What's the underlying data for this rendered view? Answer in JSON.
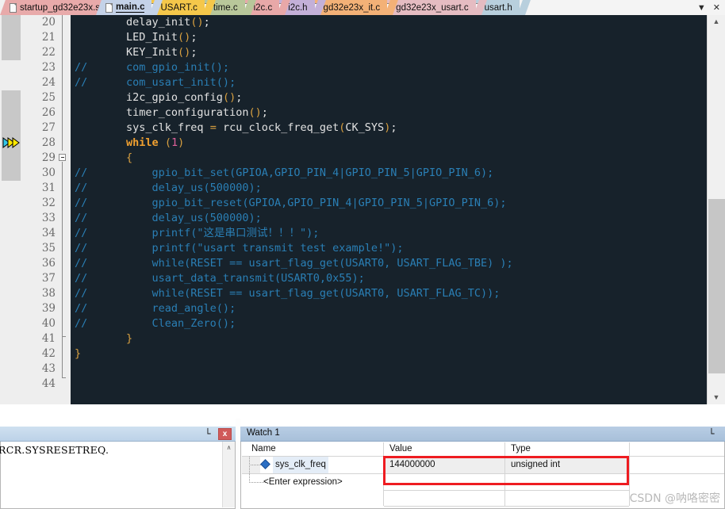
{
  "tabs": [
    {
      "label": "startup_gd32e23x.s",
      "color": "#e8aaaa",
      "active": false
    },
    {
      "label": "main.c",
      "color": "#c4d2e8",
      "active": true
    },
    {
      "label": "USART.c",
      "color": "#f5c74a",
      "active": false
    },
    {
      "label": "time.c",
      "color": "#b8c79a",
      "active": false
    },
    {
      "label": "i2c.c",
      "color": "#e8a8a8",
      "active": false
    },
    {
      "label": "i2c.h",
      "color": "#c3b0d8",
      "active": false
    },
    {
      "label": "gd32e23x_it.c",
      "color": "#f3b177",
      "active": false
    },
    {
      "label": "gd32e23x_usart.c",
      "color": "#e5bcc2",
      "active": false
    },
    {
      "label": "usart.h",
      "color": "#b8cfdd",
      "active": false
    }
  ],
  "tabbar": {
    "overflow_icon": "chevron-down-icon",
    "overflow_glyph": "▼",
    "close_icon": "close-icon",
    "close_glyph": "✕"
  },
  "editor": {
    "first_line": 20,
    "last_line": 44,
    "execution_line": 28,
    "lines": [
      {
        "n": 20,
        "tokens": [
          {
            "t": "        delay_init",
            "c": "k-plain"
          },
          {
            "t": "()",
            "c": "k-punct"
          },
          {
            "t": ";",
            "c": "k-plain"
          }
        ]
      },
      {
        "n": 21,
        "tokens": [
          {
            "t": "        LED_Init",
            "c": "k-plain"
          },
          {
            "t": "()",
            "c": "k-punct"
          },
          {
            "t": ";",
            "c": "k-plain"
          }
        ]
      },
      {
        "n": 22,
        "tokens": [
          {
            "t": "        KEY_Init",
            "c": "k-plain"
          },
          {
            "t": "()",
            "c": "k-punct"
          },
          {
            "t": ";",
            "c": "k-plain"
          }
        ]
      },
      {
        "n": 23,
        "tokens": [
          {
            "t": "//      com_gpio_init();",
            "c": "k-com"
          }
        ]
      },
      {
        "n": 24,
        "tokens": [
          {
            "t": "//      com_usart_init();",
            "c": "k-com"
          }
        ]
      },
      {
        "n": 25,
        "tokens": [
          {
            "t": "        i2c_gpio_config",
            "c": "k-plain"
          },
          {
            "t": "()",
            "c": "k-punct"
          },
          {
            "t": ";",
            "c": "k-plain"
          }
        ]
      },
      {
        "n": 26,
        "tokens": [
          {
            "t": "        timer_configuration",
            "c": "k-plain"
          },
          {
            "t": "()",
            "c": "k-punct"
          },
          {
            "t": ";",
            "c": "k-plain"
          }
        ]
      },
      {
        "n": 27,
        "tokens": [
          {
            "t": "        sys_clk_freq ",
            "c": "k-plain"
          },
          {
            "t": "=",
            "c": "k-punct"
          },
          {
            "t": " rcu_clock_freq_get",
            "c": "k-plain"
          },
          {
            "t": "(",
            "c": "k-punct"
          },
          {
            "t": "CK_SYS",
            "c": "k-plain"
          },
          {
            "t": ")",
            "c": "k-punct"
          },
          {
            "t": ";",
            "c": "k-plain"
          }
        ]
      },
      {
        "n": 28,
        "tokens": [
          {
            "t": "        ",
            "c": "k-plain"
          },
          {
            "t": "while",
            "c": "k-kw"
          },
          {
            "t": " ",
            "c": "k-plain"
          },
          {
            "t": "(",
            "c": "k-punct"
          },
          {
            "t": "1",
            "c": "k-num"
          },
          {
            "t": ")",
            "c": "k-punct"
          }
        ]
      },
      {
        "n": 29,
        "tokens": [
          {
            "t": "        ",
            "c": "k-plain"
          },
          {
            "t": "{",
            "c": "k-brace"
          }
        ]
      },
      {
        "n": 30,
        "tokens": [
          {
            "t": "//          gpio_bit_set(GPIOA,GPIO_PIN_4|GPIO_PIN_5|GPIO_PIN_6);",
            "c": "k-com"
          }
        ]
      },
      {
        "n": 31,
        "tokens": [
          {
            "t": "//          delay_us(500000);",
            "c": "k-com"
          }
        ]
      },
      {
        "n": 32,
        "tokens": [
          {
            "t": "//          gpio_bit_reset(GPIOA,GPIO_PIN_4|GPIO_PIN_5|GPIO_PIN_6);",
            "c": "k-com"
          }
        ]
      },
      {
        "n": 33,
        "tokens": [
          {
            "t": "//          delay_us(500000);",
            "c": "k-com"
          }
        ]
      },
      {
        "n": 34,
        "tokens": [
          {
            "t": "//          printf(\"这是串口测试！！！\");",
            "c": "k-com"
          }
        ]
      },
      {
        "n": 35,
        "tokens": [
          {
            "t": "//          printf(\"usart transmit test example!\");",
            "c": "k-com"
          }
        ]
      },
      {
        "n": 36,
        "tokens": [
          {
            "t": "//          while(RESET == usart_flag_get(USART0, USART_FLAG_TBE) );",
            "c": "k-com"
          }
        ]
      },
      {
        "n": 37,
        "tokens": [
          {
            "t": "//          usart_data_transmit(USART0,0x55);",
            "c": "k-com"
          }
        ]
      },
      {
        "n": 38,
        "tokens": [
          {
            "t": "//          while(RESET == usart_flag_get(USART0, USART_FLAG_TC));",
            "c": "k-com"
          }
        ]
      },
      {
        "n": 39,
        "tokens": [
          {
            "t": "//          read_angle();",
            "c": "k-com"
          }
        ]
      },
      {
        "n": 40,
        "tokens": [
          {
            "t": "//          Clean_Zero();",
            "c": "k-com"
          }
        ]
      },
      {
        "n": 41,
        "tokens": [
          {
            "t": "        ",
            "c": "k-plain"
          },
          {
            "t": "}",
            "c": "k-brace"
          }
        ]
      },
      {
        "n": 42,
        "tokens": [
          {
            "t": "",
            "c": "k-plain"
          },
          {
            "t": "}",
            "c": "k-brace"
          }
        ]
      },
      {
        "n": 43,
        "tokens": [
          {
            "t": "",
            "c": "k-plain"
          }
        ]
      },
      {
        "n": 44,
        "tokens": [
          {
            "t": "",
            "c": "k-plain"
          }
        ]
      }
    ],
    "scrollbar": {
      "v_up_glyph": "▲",
      "v_down_glyph": "▼",
      "h_left_glyph": "❮",
      "h_right_glyph": "❯"
    }
  },
  "left_panel": {
    "pin_icon": "pin-icon",
    "pin_glyph": "└",
    "close_icon": "close-icon",
    "close_label": "x",
    "content_text": "RCR.SYSRESETREQ.",
    "scroll_up_glyph": "∧"
  },
  "watch": {
    "title": "Watch 1",
    "pin_icon": "pin-icon",
    "pin_glyph": "└",
    "columns": [
      "Name",
      "Value",
      "Type"
    ],
    "rows": [
      {
        "name": "sys_clk_freq",
        "value": "144000000",
        "type": "unsigned int",
        "icon": "diamond-icon"
      },
      {
        "name": "<Enter expression>",
        "value": "",
        "type": "",
        "icon": "none"
      }
    ]
  },
  "annotation": {
    "highlight_color": "#ee1c21",
    "watermark": "CSDN @呐咯密密"
  }
}
